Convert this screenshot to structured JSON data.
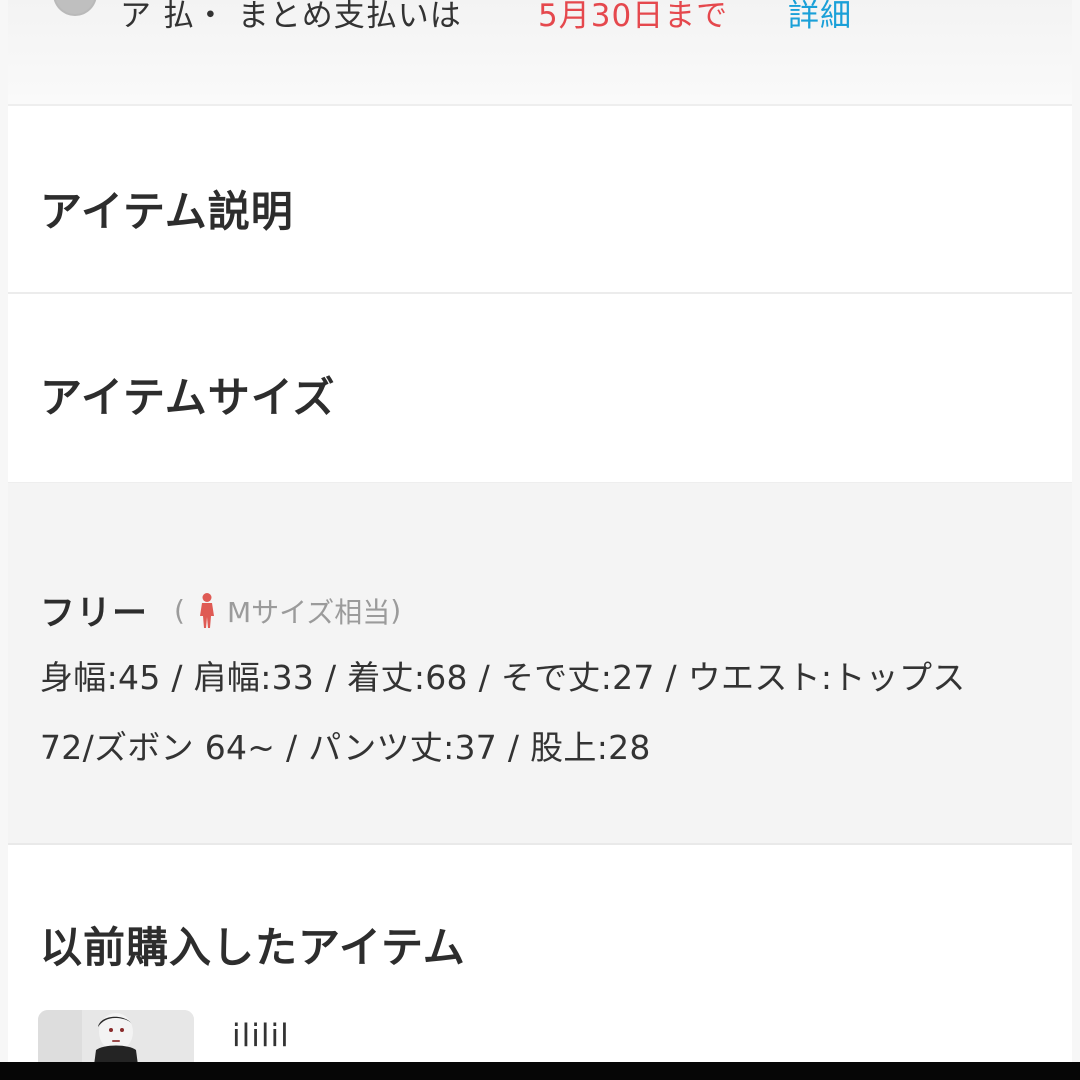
{
  "header": {
    "notice_text": "ア 払・ まとめ支払いは",
    "notice_highlight": "5月30日まで",
    "notice_link": "詳細"
  },
  "sections": {
    "item_description": "アイテム説明",
    "item_size": "アイテムサイズ",
    "previous_items": "以前購入したアイテム"
  },
  "size_info": {
    "label": "フリー",
    "paren_open": "(",
    "equivalent": "Mサイズ相当",
    "paren_close": ")",
    "measurements_line1": "身幅:45 / 肩幅:33 / 着丈:68 / そで丈:27 / ウエスト:トップス",
    "measurements_line2": "72/ズボン 64~ / パンツ丈:37 / 股上:28"
  },
  "previous_item": {
    "name": "ililil"
  },
  "colors": {
    "accent_red": "#e5484d",
    "link_blue": "#1aa0d8"
  },
  "icons": {
    "person": "person-icon",
    "notice": "notice-icon"
  }
}
